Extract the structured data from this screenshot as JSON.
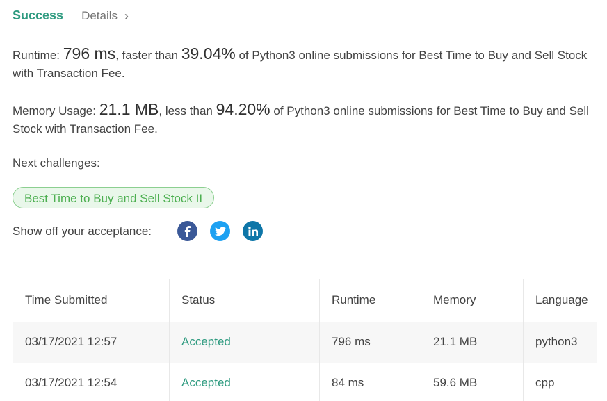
{
  "header": {
    "status": "Success",
    "details_label": "Details",
    "details_chevron": "›"
  },
  "runtime": {
    "label": "Runtime:",
    "value": "796 ms",
    "text_middle": ", faster than",
    "percent": "39.04%",
    "text_end": "of Python3 online submissions for Best Time to Buy and Sell Stock with Transaction Fee."
  },
  "memory": {
    "label": "Memory Usage:",
    "value": "21.1 MB",
    "text_middle": ", less than",
    "percent": "94.20%",
    "text_end": "of Python3 online submissions for Best Time to Buy and Sell Stock with Transaction Fee."
  },
  "next_challenges": {
    "label": "Next challenges:",
    "items": [
      "Best Time to Buy and Sell Stock II"
    ]
  },
  "share": {
    "label": "Show off your acceptance:",
    "icons": [
      "facebook-icon",
      "twitter-icon",
      "linkedin-icon"
    ]
  },
  "submissions": {
    "columns": [
      "Time Submitted",
      "Status",
      "Runtime",
      "Memory",
      "Language"
    ],
    "rows": [
      {
        "time": "03/17/2021 12:57",
        "status": "Accepted",
        "runtime": "796 ms",
        "memory": "21.1 MB",
        "language": "python3"
      },
      {
        "time": "03/17/2021 12:54",
        "status": "Accepted",
        "runtime": "84 ms",
        "memory": "59.6 MB",
        "language": "cpp"
      }
    ]
  },
  "colors": {
    "success": "#2f9b80",
    "challenge_bg": "#e9f7ea",
    "challenge_text": "#4caf50",
    "facebook": "#3b5998",
    "twitter": "#1da1f2",
    "linkedin": "#0e76a8"
  }
}
